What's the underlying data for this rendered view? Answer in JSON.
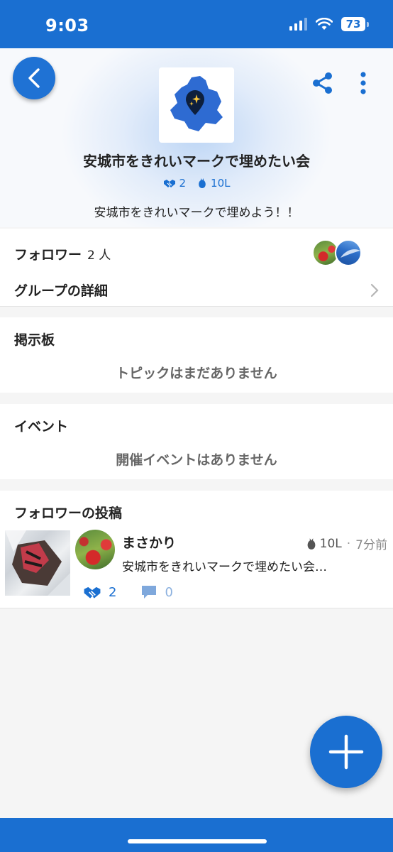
{
  "status_bar": {
    "time": "9:03",
    "battery": "73"
  },
  "header": {
    "title": "安城市をきれいマークで埋めたい会",
    "members_count": "2",
    "volume": "10L",
    "description": "安城市をきれいマークで埋めよう！！"
  },
  "followers": {
    "label": "フォロワー",
    "count": "2 人",
    "details_label": "グループの詳細"
  },
  "board": {
    "title": "掲示板",
    "empty": "トピックはまだありません"
  },
  "events": {
    "title": "イベント",
    "empty": "開催イベントはありません"
  },
  "posts": {
    "title": "フォロワーの投稿",
    "items": [
      {
        "author": "まさかり",
        "volume": "10L",
        "time": "7分前",
        "text": "安城市をきれいマークで埋めたい会…",
        "likes": "2",
        "comments": "0"
      }
    ]
  },
  "colors": {
    "primary": "#1a6fd1",
    "background": "#f5f5f5"
  },
  "icons": [
    "back-arrow-icon",
    "share-icon",
    "more-vertical-icon",
    "handshake-icon",
    "trash-bag-icon",
    "chevron-right-icon",
    "comment-icon",
    "plus-icon"
  ]
}
